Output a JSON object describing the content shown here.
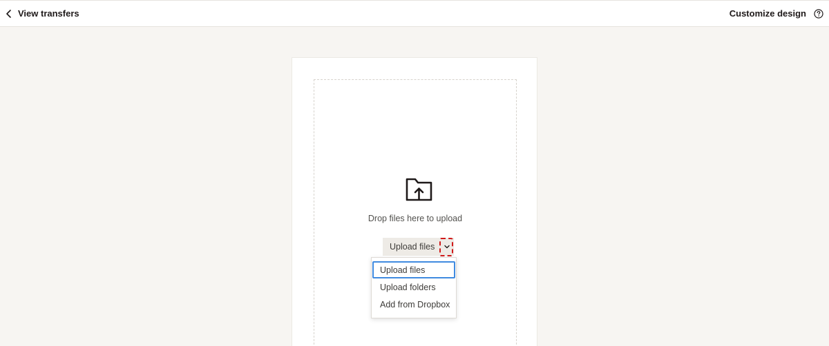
{
  "header": {
    "back_label": "View transfers",
    "customize_label": "Customize design"
  },
  "dropzone": {
    "hint": "Drop files here to upload",
    "upload_button_label": "Upload files"
  },
  "upload_menu": {
    "items": [
      {
        "label": "Upload files",
        "selected": true
      },
      {
        "label": "Upload folders",
        "selected": false
      },
      {
        "label": "Add from Dropbox",
        "selected": false
      }
    ]
  },
  "colors": {
    "page_background": "#f7f5f2",
    "button_background": "#eeebe6",
    "selection_outline": "#3f8ae0",
    "annotation_outline": "#d0191a"
  },
  "icons": [
    "chevron-left-icon",
    "help-circle-icon",
    "folder-upload-icon",
    "chevron-down-icon"
  ]
}
